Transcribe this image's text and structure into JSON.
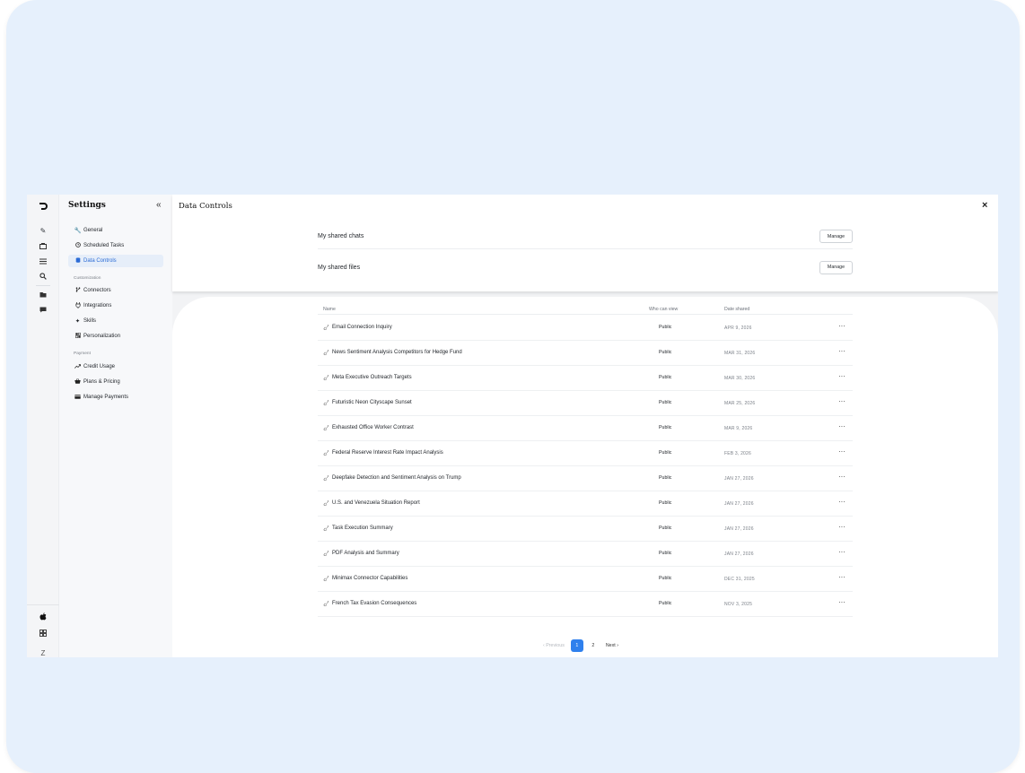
{
  "rail": {
    "icons": [
      "logo-icon",
      "edit-icon",
      "briefcase-icon",
      "sliders-icon",
      "search-icon",
      "folder-icon",
      "chat-icon"
    ],
    "bottom_icons": [
      "apple-icon",
      "grid-icon"
    ],
    "avatar_letter": "Z"
  },
  "sidebar": {
    "title": "Settings",
    "collapse_glyph": "«",
    "items_top": [
      {
        "label": "General",
        "icon": "wrench-icon"
      },
      {
        "label": "Scheduled Tasks",
        "icon": "clock-icon"
      },
      {
        "label": "Data Controls",
        "icon": "database-icon",
        "active": true
      }
    ],
    "section_customization": "Customization",
    "items_custom": [
      {
        "label": "Connectors",
        "icon": "branch-icon"
      },
      {
        "label": "Integrations",
        "icon": "plug-icon"
      },
      {
        "label": "Skills",
        "icon": "sparkle-icon"
      },
      {
        "label": "Personalization",
        "icon": "person-grid-icon"
      }
    ],
    "section_payment": "Payment",
    "items_payment": [
      {
        "label": "Credit Usage",
        "icon": "trend-icon"
      },
      {
        "label": "Plans & Pricing",
        "icon": "basket-icon"
      },
      {
        "label": "Manage Payments",
        "icon": "card-icon"
      }
    ]
  },
  "header": {
    "title": "Data Controls",
    "close_glyph": "×"
  },
  "settings": {
    "shared_chats_label": "My shared chats",
    "shared_files_label": "My shared files",
    "manage_label": "Manage"
  },
  "table": {
    "columns": {
      "name": "Name",
      "who": "Who can view",
      "date": "Date shared"
    },
    "rows": [
      {
        "name": "Email Connection Inquiry",
        "who": "Public",
        "date": "APR 9, 2026"
      },
      {
        "name": "News Sentiment Analysis Competitors for Hedge Fund",
        "who": "Public",
        "date": "MAR 31, 2026"
      },
      {
        "name": "Meta Executive Outreach Targets",
        "who": "Public",
        "date": "MAR 30, 2026"
      },
      {
        "name": "Futuristic Neon Cityscape Sunset",
        "who": "Public",
        "date": "MAR 25, 2026"
      },
      {
        "name": "Exhausted Office Worker Contrast",
        "who": "Public",
        "date": "MAR 9, 2026"
      },
      {
        "name": "Federal Reserve Interest Rate Impact Analysis",
        "who": "Public",
        "date": "FEB 3, 2026"
      },
      {
        "name": "Deepfake Detection and Sentiment Analysis on Trump",
        "who": "Public",
        "date": "JAN 27, 2026"
      },
      {
        "name": "U.S. and Venezuela Situation Report",
        "who": "Public",
        "date": "JAN 27, 2026"
      },
      {
        "name": "Task Execution Summary",
        "who": "Public",
        "date": "JAN 27, 2026"
      },
      {
        "name": "PDF Analysis and Summary",
        "who": "Public",
        "date": "JAN 27, 2026"
      },
      {
        "name": "Minimax Connector Capabilities",
        "who": "Public",
        "date": "DEC 31, 2025"
      },
      {
        "name": "French Tax Evasion Consequences",
        "who": "Public",
        "date": "NOV 3, 2025"
      }
    ],
    "more_glyph": "···",
    "link_glyph": "🔗"
  },
  "pagination": {
    "previous": "‹ Previous",
    "pages": [
      "1",
      "2"
    ],
    "current": "1",
    "next": "Next ›"
  },
  "colors": {
    "accent": "#2f80ed",
    "frame_bg": "#e6f0fc",
    "active_nav_bg": "#e6eef9"
  }
}
